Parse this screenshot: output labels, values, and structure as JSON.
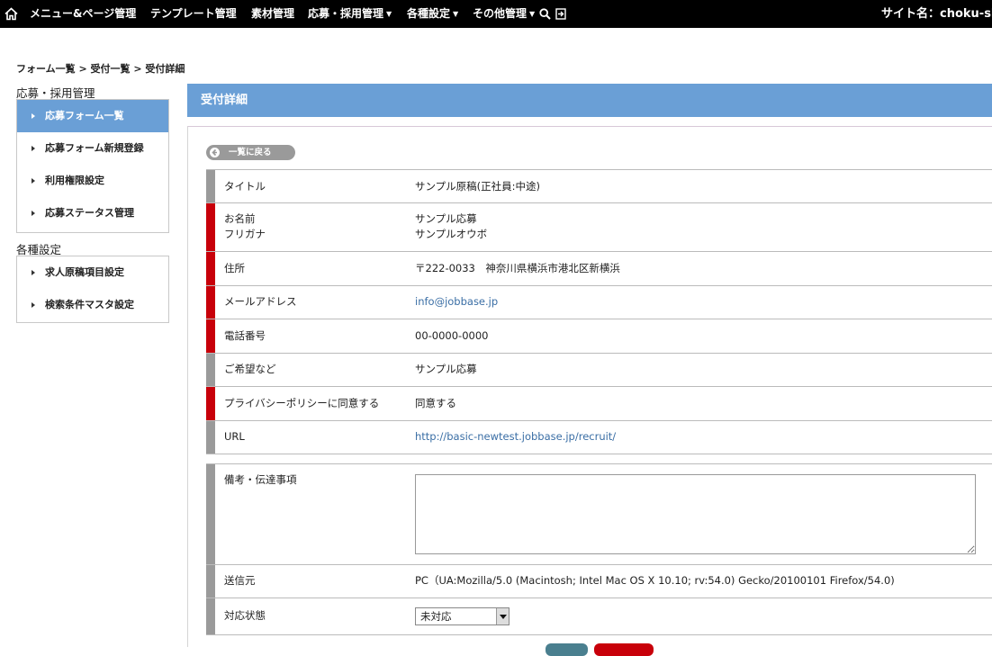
{
  "topnav": {
    "items": [
      {
        "label": "メニュー&ページ管理",
        "dropdown": false
      },
      {
        "label": "テンプレート管理",
        "dropdown": false
      },
      {
        "label": "素材管理",
        "dropdown": false
      },
      {
        "label": "応募・採用管理",
        "dropdown": true
      },
      {
        "label": "各種設定",
        "dropdown": true
      },
      {
        "label": "その他管理",
        "dropdown": true
      }
    ],
    "site_label": "サイト名：choku-shi",
    "icons": [
      "home-icon",
      "search-icon",
      "logout-icon"
    ]
  },
  "breadcrumb": "フォーム一覧 > 受付一覧 > 受付詳細",
  "sidebar": {
    "groups": [
      {
        "heading": "応募・採用管理",
        "items": [
          {
            "label": "応募フォーム一覧",
            "active": true
          },
          {
            "label": "応募フォーム新規登録",
            "active": false
          },
          {
            "label": "利用権限設定",
            "active": false
          },
          {
            "label": "応募ステータス管理",
            "active": false
          }
        ]
      },
      {
        "heading": "各種設定",
        "items": [
          {
            "label": "求人原稿項目設定",
            "active": false
          },
          {
            "label": "検索条件マスタ設定",
            "active": false
          }
        ]
      }
    ]
  },
  "main": {
    "title": "受付詳細",
    "back_button": "一覧に戻る",
    "rows": [
      {
        "label": "タイトル",
        "value": "サンプル原稿(正社員:中途)",
        "required": false
      },
      {
        "label": "お名前",
        "label2": "フリガナ",
        "value": "サンプル応募",
        "value2": "サンプルオウボ",
        "required": true
      },
      {
        "label": "住所",
        "value": "〒222-0033　神奈川県横浜市港北区新横浜",
        "required": true
      },
      {
        "label": "メールアドレス",
        "value": "info@jobbase.jp",
        "required": true,
        "link": true
      },
      {
        "label": "電話番号",
        "value": "00-0000-0000",
        "required": true
      },
      {
        "label": "ご希望など",
        "value": "サンプル応募",
        "required": false
      },
      {
        "label": "プライバシーポリシーに同意する",
        "value": "同意する",
        "required": true
      },
      {
        "label": "URL",
        "value": "http://basic-newtest.jobbase.jp/recruit/",
        "required": false,
        "link": true
      }
    ],
    "memo": {
      "label": "備考・伝達事項",
      "value": ""
    },
    "source": {
      "label": "送信元",
      "value": "PC（UA:Mozilla/5.0 (Macintosh; Intel Mac OS X 10.10; rv:54.0) Gecko/20100101 Firefox/54.0)"
    },
    "status": {
      "label": "対応状態",
      "selected": "未対応"
    }
  },
  "colors": {
    "accent": "#6a9fd6",
    "required": "#c8000a",
    "optional": "#9a9a9a",
    "link": "#3a6ea5"
  }
}
